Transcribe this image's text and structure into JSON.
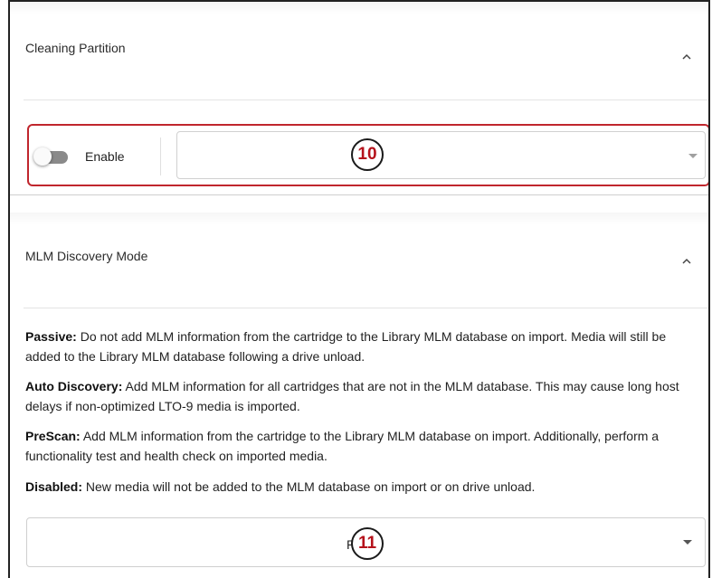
{
  "cleaning_partition": {
    "title": "Cleaning Partition",
    "enable_label": "Enable",
    "enabled": false,
    "select_value": "",
    "callout": "10"
  },
  "mlm_discovery": {
    "title": "MLM Discovery Mode",
    "descriptions": [
      {
        "term": "Passive:",
        "text": " Do not add MLM information from the cartridge to the Library MLM database on import. Media will still be added to the Library MLM database following a drive unload."
      },
      {
        "term": "Auto Discovery:",
        "text": " Add MLM information for all cartridges that are not in the MLM database. This may cause long host delays if non-optimized LTO-9 media is imported."
      },
      {
        "term": "PreScan:",
        "text": " Add MLM information from the cartridge to the Library MLM database on import. Additionally, perform a functionality test and health check on imported media."
      },
      {
        "term": "Disabled:",
        "text": " New media will not be added to the MLM database on import or on drive unload."
      }
    ],
    "select_value": "Pa",
    "callout": "11"
  },
  "colors": {
    "highlight": "#c0262d",
    "callout_text": "#b5121b"
  }
}
